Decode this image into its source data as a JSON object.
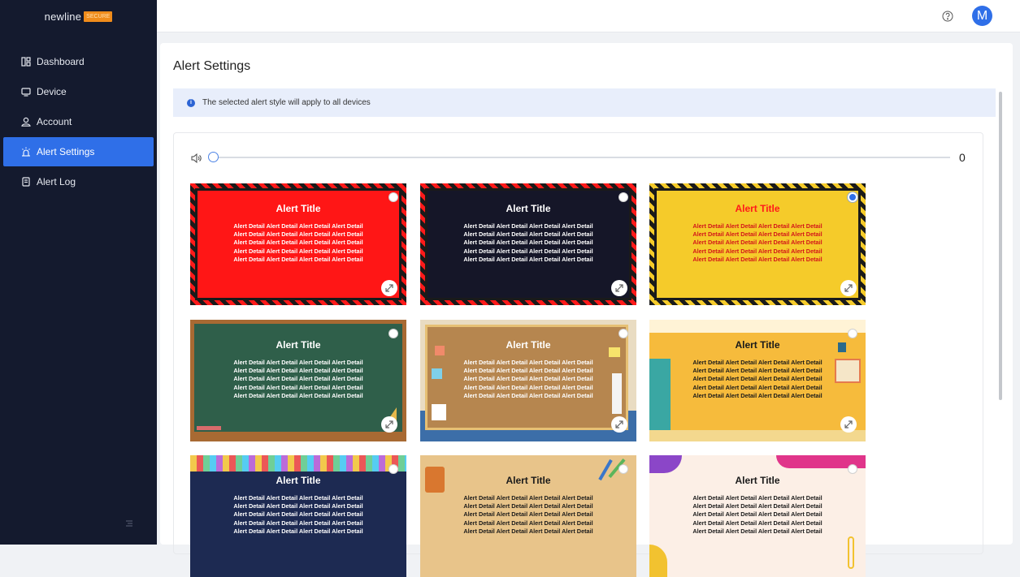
{
  "brand": {
    "name": "newline",
    "badge": "SECURE"
  },
  "nav": [
    {
      "label": "Dashboard",
      "icon": "dashboard-icon"
    },
    {
      "label": "Device",
      "icon": "monitor-icon"
    },
    {
      "label": "Account",
      "icon": "user-icon"
    },
    {
      "label": "Alert Settings",
      "icon": "alarm-icon",
      "active": true
    },
    {
      "label": "Alert Log",
      "icon": "document-icon"
    }
  ],
  "topbar": {
    "help_icon": "help-circle-icon",
    "avatar_letter": "M"
  },
  "page": {
    "title": "Alert Settings",
    "info": "The selected alert style will apply to all devices"
  },
  "volume": {
    "value": "0",
    "level": 0
  },
  "cards": {
    "title": "Alert Title",
    "detail_lines": [
      "Alert Detail Alert Detail Alert Detail Alert Detail",
      "Alert Detail Alert Detail Alert Detail Alert Detail",
      "Alert Detail Alert Detail Alert Detail Alert Detail",
      "Alert Detail Alert Detail Alert Detail Alert Detail",
      "Alert Detail Alert Detail Alert Detail Alert Detail"
    ],
    "selected_index": 2
  },
  "colors": {
    "accent": "#2f6fe8",
    "sidebar": "#141a2e"
  }
}
